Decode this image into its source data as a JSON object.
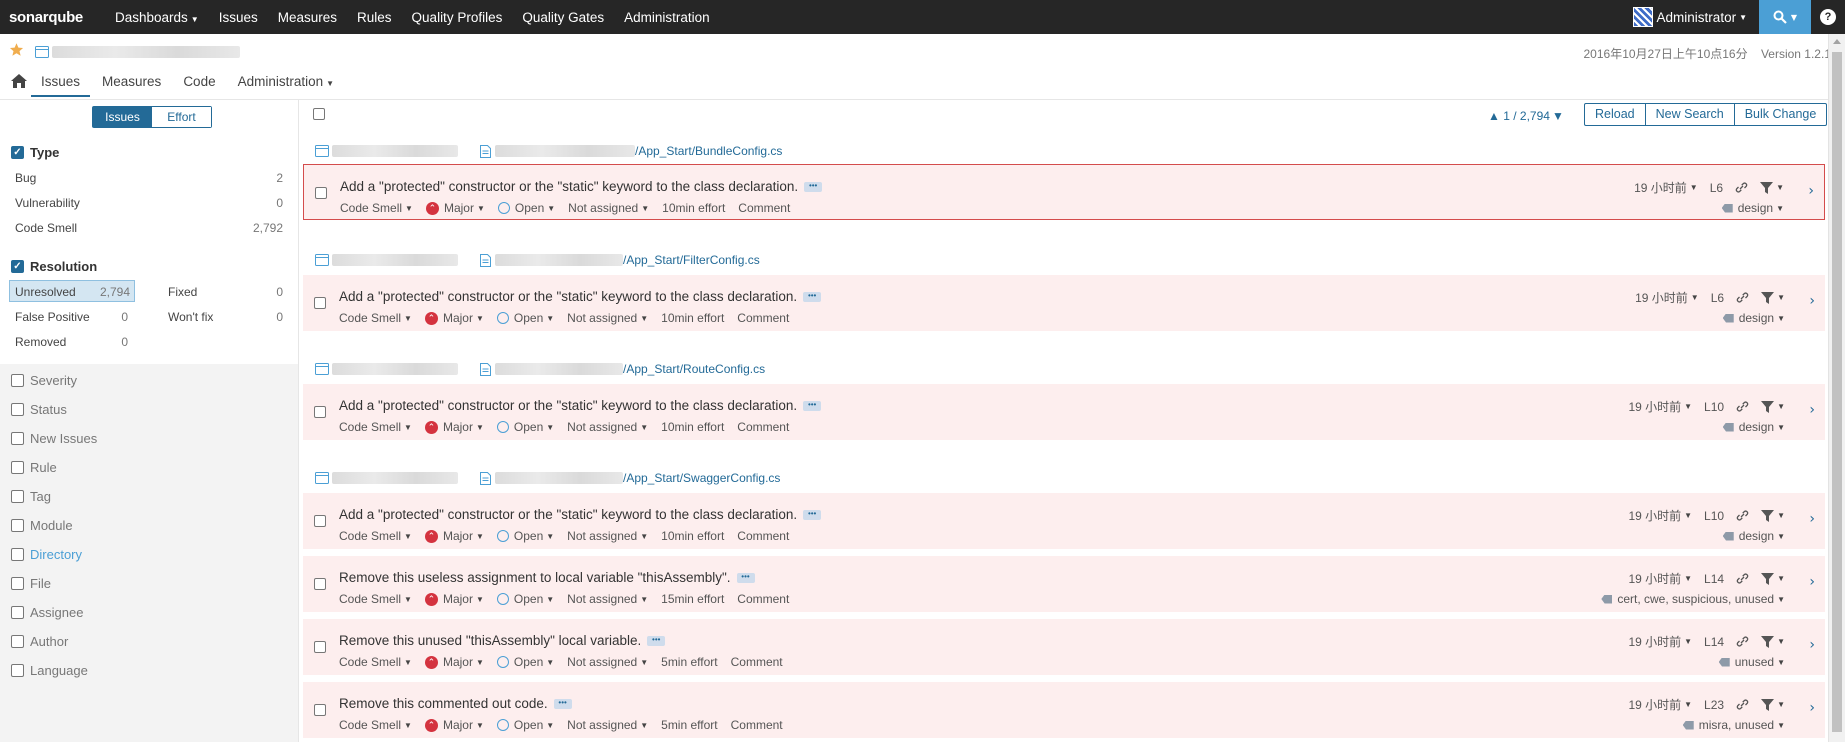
{
  "topnav": {
    "logo": "sonarqube",
    "items": [
      "Dashboards",
      "Issues",
      "Measures",
      "Rules",
      "Quality Profiles",
      "Quality Gates",
      "Administration"
    ],
    "user": "Administrator"
  },
  "project": {
    "date": "2016年10月27日上午10点16分",
    "version": "Version 1.2.1",
    "tabs": [
      "Issues",
      "Measures",
      "Code",
      "Administration"
    ]
  },
  "sidebar": {
    "mode": [
      "Issues",
      "Effort"
    ],
    "type": {
      "title": "Type",
      "items": [
        {
          "label": "Bug",
          "count": "2"
        },
        {
          "label": "Vulnerability",
          "count": "0"
        },
        {
          "label": "Code Smell",
          "count": "2,792"
        }
      ]
    },
    "resolution": {
      "title": "Resolution",
      "items": [
        {
          "label": "Unresolved",
          "count": "2,794"
        },
        {
          "label": "Fixed",
          "count": "0"
        },
        {
          "label": "False Positive",
          "count": "0"
        },
        {
          "label": "Won't fix",
          "count": "0"
        },
        {
          "label": "Removed",
          "count": "0"
        }
      ]
    },
    "facets": [
      "Severity",
      "Status",
      "New Issues",
      "Rule",
      "Tag",
      "Module",
      "Directory",
      "File",
      "Assignee",
      "Author",
      "Language"
    ]
  },
  "toolbar": {
    "paging": "1 / 2,794",
    "buttons": [
      "Reload",
      "New Search",
      "Bulk Change"
    ]
  },
  "issues": [
    {
      "file": "/App_Start/BundleConfig.cs",
      "message": "Add a \"protected\" constructor or the \"static\" keyword to the class declaration.",
      "type": "Code Smell",
      "severity": "Major",
      "status": "Open",
      "assignee": "Not assigned",
      "effort": "10min effort",
      "comment": "Comment",
      "age": "19 小时前",
      "line": "L6",
      "tags": "design"
    },
    {
      "file": "/App_Start/FilterConfig.cs",
      "message": "Add a \"protected\" constructor or the \"static\" keyword to the class declaration.",
      "type": "Code Smell",
      "severity": "Major",
      "status": "Open",
      "assignee": "Not assigned",
      "effort": "10min effort",
      "comment": "Comment",
      "age": "19 小时前",
      "line": "L6",
      "tags": "design"
    },
    {
      "file": "/App_Start/RouteConfig.cs",
      "message": "Add a \"protected\" constructor or the \"static\" keyword to the class declaration.",
      "type": "Code Smell",
      "severity": "Major",
      "status": "Open",
      "assignee": "Not assigned",
      "effort": "10min effort",
      "comment": "Comment",
      "age": "19 小时前",
      "line": "L10",
      "tags": "design"
    },
    {
      "file": "/App_Start/SwaggerConfig.cs",
      "message": "Add a \"protected\" constructor or the \"static\" keyword to the class declaration.",
      "type": "Code Smell",
      "severity": "Major",
      "status": "Open",
      "assignee": "Not assigned",
      "effort": "10min effort",
      "comment": "Comment",
      "age": "19 小时前",
      "line": "L10",
      "tags": "design"
    },
    {
      "file": "",
      "message": "Remove this useless assignment to local variable \"thisAssembly\".",
      "type": "Code Smell",
      "severity": "Major",
      "status": "Open",
      "assignee": "Not assigned",
      "effort": "15min effort",
      "comment": "Comment",
      "age": "19 小时前",
      "line": "L14",
      "tags": "cert, cwe, suspicious, unused"
    },
    {
      "file": "",
      "message": "Remove this unused \"thisAssembly\" local variable.",
      "type": "Code Smell",
      "severity": "Major",
      "status": "Open",
      "assignee": "Not assigned",
      "effort": "5min effort",
      "comment": "Comment",
      "age": "19 小时前",
      "line": "L14",
      "tags": "unused"
    },
    {
      "file": "",
      "message": "Remove this commented out code.",
      "type": "Code Smell",
      "severity": "Major",
      "status": "Open",
      "assignee": "Not assigned",
      "effort": "5min effort",
      "comment": "Comment",
      "age": "19 小时前",
      "line": "L23",
      "tags": "misra, unused"
    }
  ]
}
